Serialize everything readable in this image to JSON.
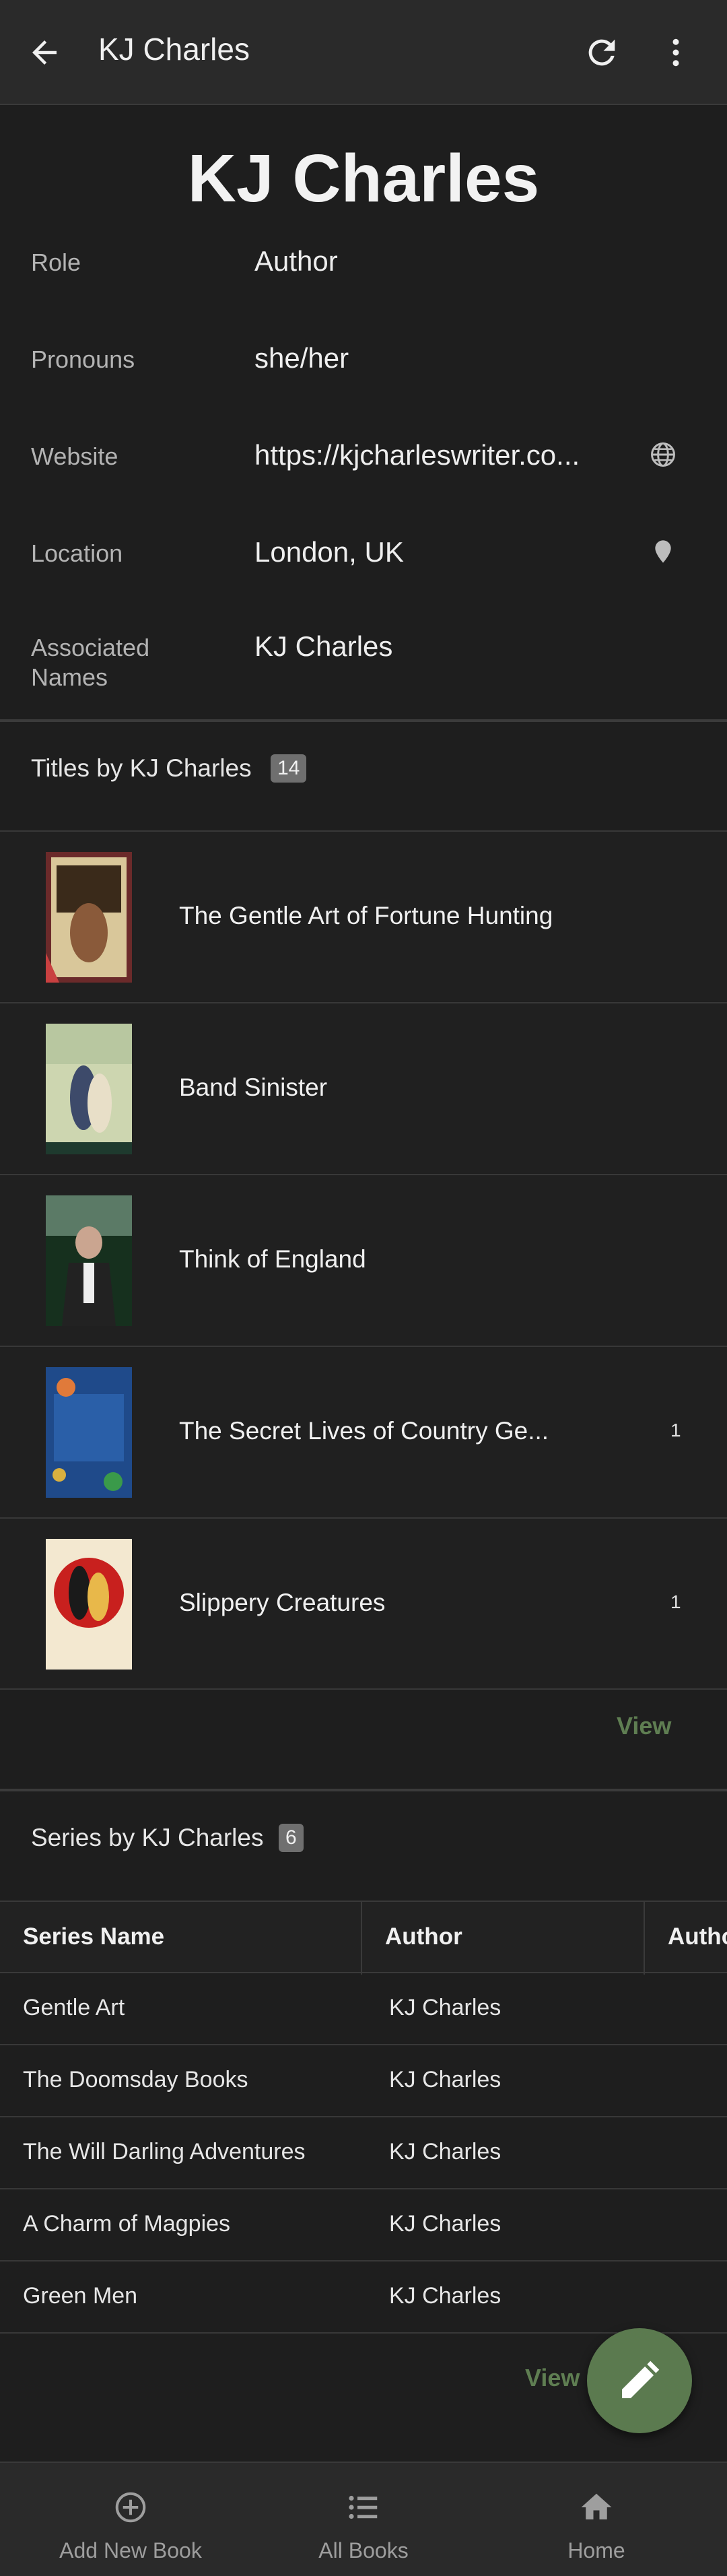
{
  "appbar": {
    "title": "KJ Charles",
    "back_icon": "arrow-left-icon",
    "refresh_icon": "refresh-icon",
    "more_icon": "more-vertical-icon"
  },
  "author": {
    "name": "KJ Charles",
    "details": [
      {
        "label": "Role",
        "value": "Author"
      },
      {
        "label": "Pronouns",
        "value": "she/her"
      },
      {
        "label": "Website",
        "value": "https://kjcharleswriter.co...",
        "icon": "globe-icon"
      },
      {
        "label": "Location",
        "value": "London, UK",
        "icon": "map-pin-icon"
      },
      {
        "label": "Associated Names",
        "value": "KJ Charles"
      }
    ]
  },
  "titles": {
    "heading": "Titles by KJ Charles",
    "count": "14",
    "books": [
      {
        "title": "The Gentle Art of Fortune Hunting",
        "count": ""
      },
      {
        "title": "Band Sinister",
        "count": ""
      },
      {
        "title": "Think of England",
        "count": ""
      },
      {
        "title": "The Secret Lives of Country Ge...",
        "count": "1"
      },
      {
        "title": "Slippery Creatures",
        "count": "1"
      }
    ],
    "view_label": "View"
  },
  "series": {
    "heading": "Series by KJ Charles",
    "count": "6",
    "columns": [
      "Series Name",
      "Author",
      "Autho"
    ],
    "rows": [
      [
        "Gentle Art",
        "KJ Charles"
      ],
      [
        "The Doomsday Books",
        "KJ Charles"
      ],
      [
        "The Will Darling Adventures",
        "KJ Charles"
      ],
      [
        "A Charm of Magpies",
        "KJ Charles"
      ],
      [
        "Green Men",
        "KJ Charles"
      ]
    ],
    "view_label": "View"
  },
  "fab": {
    "icon": "edit-icon"
  },
  "bottom_nav": [
    {
      "label": "Add New Book",
      "icon": "add-circle-icon"
    },
    {
      "label": "All Books",
      "icon": "list-icon"
    },
    {
      "label": "Home",
      "icon": "home-icon"
    }
  ],
  "colors": {
    "background": "#1e1e1e",
    "appbar": "#2a2a2a",
    "accent": "#5b7a4f",
    "view_link": "#5f7e52"
  }
}
